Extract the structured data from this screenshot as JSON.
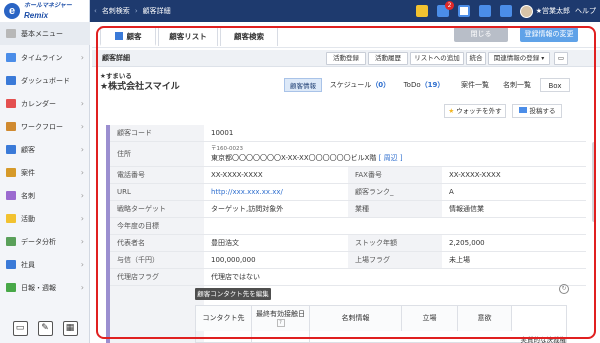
{
  "header": {
    "logo_line1": "ホールマネジャー",
    "logo_line2": "Remix",
    "logo_mark": "e",
    "breadcrumbs": [
      "名刺検索",
      "顧客詳細"
    ],
    "notification_count": "2",
    "user_name": "★営業太郎",
    "help_label": "ヘルプ"
  },
  "sidebar": {
    "items": [
      {
        "label": "基本メニュー",
        "icon": "menu-icon",
        "color": "#b8b8b8"
      },
      {
        "label": "タイムライン",
        "icon": "timeline-icon",
        "color": "#4b8de8"
      },
      {
        "label": "ダッシュボード",
        "icon": "dashboard-icon",
        "color": "#3a7ad8"
      },
      {
        "label": "カレンダー",
        "icon": "calendar-icon",
        "color": "#e45050"
      },
      {
        "label": "ワークフロー",
        "icon": "workflow-icon",
        "color": "#d08a30"
      },
      {
        "label": "顧客",
        "icon": "customer-icon",
        "color": "#3a7ad8"
      },
      {
        "label": "案件",
        "icon": "deal-icon",
        "color": "#d69a2a"
      },
      {
        "label": "名刺",
        "icon": "card-icon",
        "color": "#9b6ad0"
      },
      {
        "label": "活動",
        "icon": "activity-icon",
        "color": "#f2c230"
      },
      {
        "label": "データ分析",
        "icon": "analysis-icon",
        "color": "#5aa05a"
      },
      {
        "label": "社員",
        "icon": "staff-icon",
        "color": "#3a7ad8"
      },
      {
        "label": "日報・週報",
        "icon": "report-icon",
        "color": "#48a848"
      }
    ]
  },
  "tabs": [
    {
      "label": "顧客"
    },
    {
      "label": "顧客リスト"
    },
    {
      "label": "顧客検索"
    }
  ],
  "actions": {
    "close_label": "閉じる",
    "edit_label": "登録情報の変更"
  },
  "toolbar": {
    "title": "顧客詳細",
    "buttons": [
      "活動登録",
      "活動履歴",
      "リストへの追加",
      "統合",
      "関連情報の登録"
    ]
  },
  "customer": {
    "label": "★すまいる",
    "name": "★株式会社スマイル"
  },
  "view_tabs": [
    {
      "label": "顧客情報",
      "count": ""
    },
    {
      "label": "スケジュール",
      "count": "（0）"
    },
    {
      "label": "ToDo",
      "count": "（19）"
    },
    {
      "label": "案件一覧",
      "count": ""
    },
    {
      "label": "名刺一覧",
      "count": ""
    },
    {
      "label": "Box",
      "count": ""
    }
  ],
  "watch_label": "ウォッチを外す",
  "post_label": "投稿する",
  "fields": {
    "code": {
      "label": "顧客コード",
      "value": "10001"
    },
    "address": {
      "label": "住所",
      "zip": "〒160-0023",
      "value": "東京都〇〇〇〇〇〇〇X-XX-XX〇〇〇〇〇〇ビルX階",
      "map_link": "[ 周辺 ]"
    },
    "phone": {
      "label": "電話番号",
      "value": "XX-XXXX-XXXX"
    },
    "fax": {
      "label": "FAX番号",
      "value": "XX-XXXX-XXXX"
    },
    "url": {
      "label": "URL",
      "value": "http://xxx.xxx.xx.xx/"
    },
    "rank": {
      "label": "顧客ランク_",
      "value": "A"
    },
    "target": {
      "label": "戦略ターゲット",
      "value": "ターゲット,訪問対象外"
    },
    "industry": {
      "label": "業種",
      "value": "情報通信業"
    },
    "goal": {
      "label": "今年度の目標",
      "value": ""
    },
    "rep": {
      "label": "代表者名",
      "value": "豊田浩文"
    },
    "stock": {
      "label": "ストック年額",
      "value": "2,205,000"
    },
    "credit": {
      "label": "与信（千円）",
      "value": "100,000,000"
    },
    "listed": {
      "label": "上場フラグ",
      "value": "未上場"
    },
    "agent": {
      "label": "代理店フラグ",
      "value": "代理店ではない"
    }
  },
  "contacts": {
    "title": "顧客コンタクト先を編集",
    "headers": [
      "コンタクト先",
      "最終有効接触日",
      "名刺情報",
      "立場",
      "意欲"
    ],
    "partial_value": "実質的な決裁権"
  }
}
